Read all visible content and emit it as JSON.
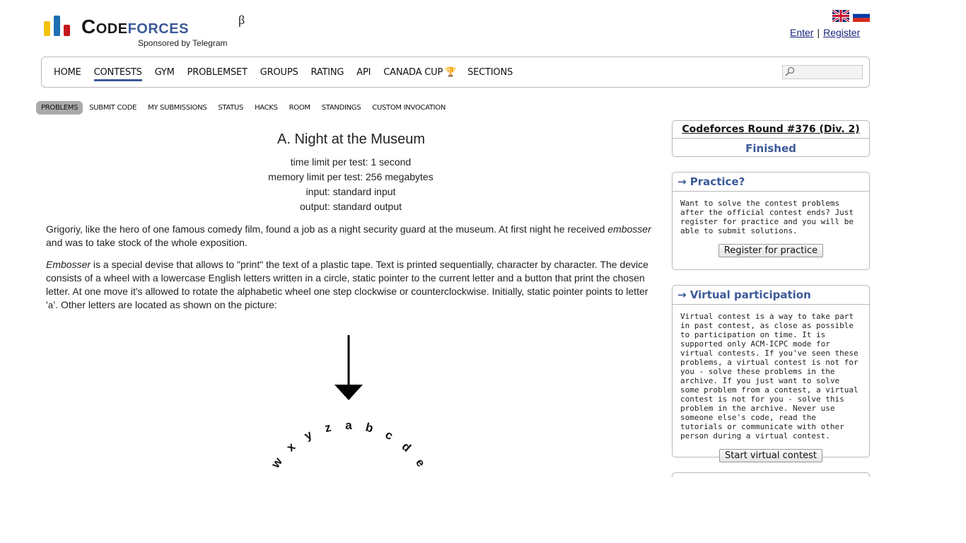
{
  "header": {
    "logo_part1": "Code",
    "logo_part2": "forces",
    "beta": "β",
    "sponsor": "Sponsored by Telegram",
    "enter": "Enter",
    "separator": "|",
    "register": "Register",
    "flags": [
      "english-flag-icon",
      "russian-flag-icon"
    ]
  },
  "menu": {
    "items": [
      "HOME",
      "CONTESTS",
      "GYM",
      "PROBLEMSET",
      "GROUPS",
      "RATING",
      "API",
      "CANADA CUP",
      "SECTIONS"
    ],
    "active": "CONTESTS"
  },
  "submenu": {
    "items": [
      "PROBLEMS",
      "SUBMIT CODE",
      "MY SUBMISSIONS",
      "STATUS",
      "HACKS",
      "ROOM",
      "STANDINGS",
      "CUSTOM INVOCATION"
    ],
    "active": "PROBLEMS"
  },
  "problem": {
    "title": "A. Night at the Museum",
    "time_limit": "time limit per test: 1 second",
    "memory_limit": "memory limit per test: 256 megabytes",
    "input": "input: standard input",
    "output": "output: standard output",
    "p1_a": "Grigoriy, like the hero of one famous comedy film, found a job as a night security guard at the museum. At first night he received ",
    "p1_em": "embosser",
    "p1_b": " and was to take stock of the whole exposition.",
    "p2_em": "Embosser",
    "p2_a": " is a special devise that allows to \"print\" the text of a plastic tape. Text is printed sequentially, character by character. The device consists of a wheel with a lowercase English letters written in a circle, static pointer to the current letter and a button that print the chosen letter. At one move it's allowed to rotate the alphabetic wheel one step clockwise or counterclockwise. Initially, static pointer points to letter '",
    "p2_code": "a",
    "p2_b": "'. Other letters are located as shown on the picture:",
    "wheel_letters": [
      "w",
      "x",
      "y",
      "z",
      "a",
      "b",
      "c",
      "d",
      "e"
    ]
  },
  "sidebar": {
    "contest_name": "Codeforces Round #376 (Div. 2)",
    "contest_status": "Finished",
    "practice_title": "→ Practice?",
    "practice_text": "Want to solve the contest problems after the official contest ends? Just register for practice and you will be able to submit solutions.",
    "practice_button": "Register for practice",
    "virtual_title": "→ Virtual participation",
    "virtual_text": "Virtual contest is a way to take part in past contest, as close as possible to participation on time. It is supported only ACM-ICPC mode for virtual contests. If you've seen these problems, a virtual contest is not for you - solve these problems in the archive. If you just want to solve some problem from a contest, a virtual contest is not for you - solve this problem in the archive. Never use someone else's code, read the tutorials or communicate with other person during a virtual contest.",
    "virtual_button": "Start virtual contest"
  },
  "colors": {
    "brand_blue": "#3b5998",
    "logo_yellow": "#f4c20d",
    "logo_blue": "#1f6fb2",
    "logo_red": "#c4161c"
  }
}
